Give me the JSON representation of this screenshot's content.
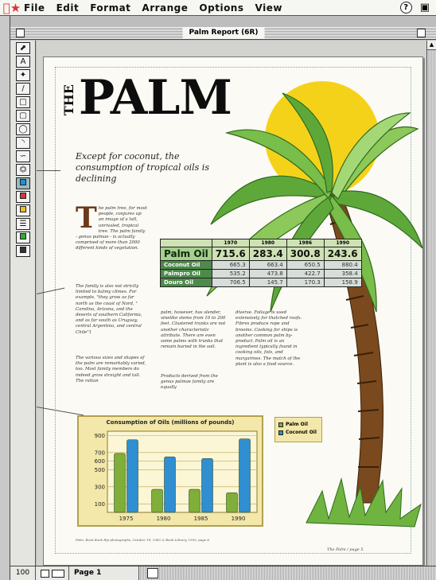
{
  "menubar": {
    "items": [
      "File",
      "Edit",
      "Format",
      "Arrange",
      "Options",
      "View"
    ],
    "help_glyph": "?"
  },
  "window": {
    "title": "Palm Report (6R)"
  },
  "document": {
    "vertical_word": "THE",
    "title": "PALM",
    "subtitle": "Except for coconut, the consumption of tropical oils is declining",
    "dropcap": "T",
    "col1a": "he palm tree, for most people, conjures up an image of a tall, unrivaled, tropical tree. The palm family - genus palmae - is actually comprised of more than 2000 different kinds of vegetation.",
    "col1b": "The family is also not strictly limited to balmy climes. For example, \"they grow as far north as the coast of Nord, \" Carolina, Arizona, and the deserts of southern California, and as far south as Uruguay, central Argentina, and central Chile\"1",
    "col1c": "The various sizes and shapes of the palm are remarkably varied, too. Most family members do indeed grow straight and tall. The rattan",
    "col2": "palm, however, has slender, vinelike stems from 10 to 200 feet. Clustered trunks are not another characteristic attribute. There are even some palms with trunks that remain buried in the soil.",
    "col2b": "Products derived from the genus palmae family are equally",
    "col3": "diverse. Foliage is used extensively for thatched roofs. Fibres produce rope and brooms. Cooking for ships is another common palm by-product. Palm oil is an ingredient typically found in cooking oils, fats, and margarines. The match of the plant is also a food source.",
    "footnote": "Palm, Bock Book Rip photographs, October 18, 1983 & Book Library, 1993, page 8",
    "folio": "The Palm / page 5"
  },
  "table": {
    "headers": [
      "1970",
      "1980",
      "1986",
      "1990"
    ],
    "rows": [
      {
        "name": "Palm Oil",
        "values": [
          "715.6",
          "283.4",
          "300.8",
          "243.6"
        ]
      },
      {
        "name": "Coconut Oil",
        "values": [
          "665.3",
          "663.4",
          "650.5",
          "880.4"
        ]
      },
      {
        "name": "Palmpro Oil",
        "values": [
          "535.2",
          "473.8",
          "422.7",
          "358.4"
        ]
      },
      {
        "name": "Douro Oil",
        "values": [
          "706.5",
          "145.7",
          "170.3",
          "158.9"
        ]
      }
    ]
  },
  "chart_data": {
    "type": "bar",
    "title": "Consumption of Oils (millions of pounds)",
    "categories": [
      "1975",
      "1980",
      "1985",
      "1990"
    ],
    "series": [
      {
        "name": "Palm Oil",
        "values": [
          690,
          270,
          270,
          230
        ],
        "color": "#7fae3a"
      },
      {
        "name": "Coconut Oil",
        "values": [
          850,
          650,
          630,
          860
        ],
        "color": "#2f8fd0"
      }
    ],
    "yticks": [
      "900",
      "700",
      "600",
      "500",
      "300",
      "100"
    ],
    "ylim": [
      0,
      950
    ],
    "grid": true,
    "legend": "right"
  },
  "statusbar": {
    "zoom": "100",
    "page_label": "Page 1"
  },
  "colors": {
    "sun": "#f5d21a",
    "trunk": "#7a4a1e",
    "leaf": "#5ea83a",
    "chart_bg": "#f3e8a9"
  }
}
